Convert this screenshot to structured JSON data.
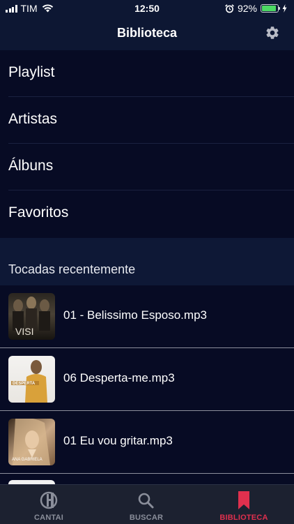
{
  "status_bar": {
    "carrier": "TIM",
    "time": "12:50",
    "battery": "92%",
    "battery_level": 0.92
  },
  "header": {
    "title": "Biblioteca",
    "settings_icon": "gear-icon"
  },
  "menu": [
    {
      "label": "Playlist"
    },
    {
      "label": "Artistas"
    },
    {
      "label": "Álbuns"
    },
    {
      "label": "Favoritos"
    }
  ],
  "recent": {
    "section_title": "Tocadas recentemente",
    "tracks": [
      {
        "title": "01 - Belissimo Esposo.mp3",
        "cover_text": "VISI"
      },
      {
        "title": "06 Desperta-me.mp3",
        "cover_text": "DESPERTA"
      },
      {
        "title": "01 Eu vou gritar.mp3",
        "cover_text": "ANA GABRIELA"
      }
    ]
  },
  "tabs": [
    {
      "label": "CANTAI",
      "icon": "cantai-logo-icon",
      "active": false
    },
    {
      "label": "BUSCAR",
      "icon": "search-icon",
      "active": false
    },
    {
      "label": "BIBLIOTECA",
      "icon": "bookmark-icon",
      "active": true
    }
  ],
  "colors": {
    "background": "#070b24",
    "header": "#0d1733",
    "active_tab": "#e0304e",
    "inactive_tab": "#8a8e9a",
    "battery": "#4cd964"
  }
}
